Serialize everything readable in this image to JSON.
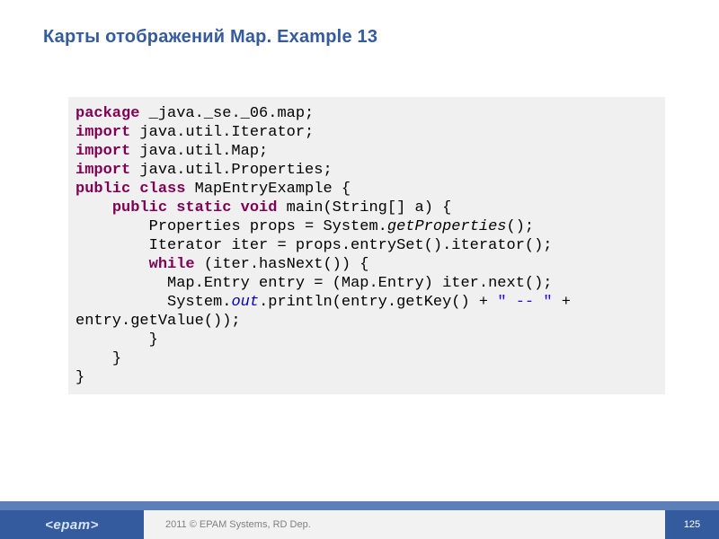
{
  "title": "Карты отображений Map. Example 13",
  "code": {
    "line1_kw": "package",
    "line1_rest": " _java._se._06.map;",
    "line2_kw": "import",
    "line2_rest": " java.util.Iterator;",
    "line3_kw": "import",
    "line3_rest": " java.util.Map;",
    "line4_kw": "import",
    "line4_rest": " java.util.Properties;",
    "line5_kw1": "public",
    "line5_kw2": "class",
    "line5_rest": " MapEntryExample {",
    "line6_indent": "    ",
    "line6_kw1": "public",
    "line6_kw2": "static",
    "line6_kw3": "void",
    "line6_rest": " main(String[] a) {",
    "line7": "        Properties props = System.",
    "line7_em": "getProperties",
    "line7_end": "();",
    "line8": "        Iterator iter = props.entrySet().iterator();",
    "line9_indent": "        ",
    "line9_kw": "while",
    "line9_rest": " (iter.hasNext()) {",
    "line10": "          Map.Entry entry = (Map.Entry) iter.next();",
    "line11a": "          System.",
    "line11_fld": "out",
    "line11b": ".println(entry.getKey() + ",
    "line11_str": "\" -- \"",
    "line11c": " + entry.getValue());",
    "line12": "        }",
    "line13": "    }",
    "line14": "}"
  },
  "footer": {
    "logo": "<epam>",
    "copyright": "2011 © EPAM Systems, RD Dep.",
    "page": "125"
  }
}
